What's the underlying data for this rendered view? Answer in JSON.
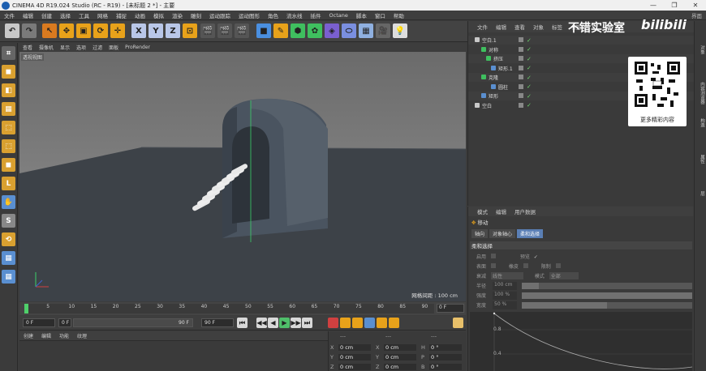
{
  "window": {
    "title": "CINEMA 4D R19.024 Studio (RC - R19) - [未标题 2 *] - 主要",
    "controls": [
      "—",
      "❐",
      "✕"
    ]
  },
  "menubar": {
    "items": [
      "文件",
      "编辑",
      "创建",
      "选择",
      "工具",
      "网格",
      "捕捉",
      "动画",
      "模拟",
      "渲染",
      "雕刻",
      "运动跟踪",
      "运动图形",
      "角色",
      "流水线",
      "插件",
      "Octane",
      "脚本",
      "窗口",
      "帮助"
    ],
    "right": "界面"
  },
  "toolbar": {
    "buttons": [
      {
        "name": "undo-button",
        "glyph": "↶",
        "color": "#c8c8c8"
      },
      {
        "name": "redo-button",
        "glyph": "↷",
        "color": "#7a7a7a"
      },
      {
        "name": "live-select-button",
        "glyph": "↖",
        "color": "#d97a1f"
      },
      {
        "name": "move-button",
        "glyph": "✥",
        "color": "#e8a21a"
      },
      {
        "name": "scale-button",
        "glyph": "▣",
        "color": "#e8a21a"
      },
      {
        "name": "rotate-button",
        "glyph": "⟳",
        "color": "#e8a21a"
      },
      {
        "name": "recent-tool-button",
        "glyph": "✛",
        "color": "#e8a21a"
      },
      {
        "name": "axis-x-button",
        "glyph": "X",
        "color": "#b9c7e8"
      },
      {
        "name": "axis-y-button",
        "glyph": "Y",
        "color": "#b9c7e8"
      },
      {
        "name": "axis-z-button",
        "glyph": "Z",
        "color": "#b9c7e8"
      },
      {
        "name": "coordinate-system-button",
        "glyph": "⊡",
        "color": "#e8a21a"
      },
      {
        "name": "render-view-button",
        "glyph": "🎬",
        "color": "#555"
      },
      {
        "name": "render-picture-viewer-button",
        "glyph": "🎬",
        "color": "#555"
      },
      {
        "name": "render-settings-button",
        "glyph": "🎬",
        "color": "#555"
      },
      {
        "name": "cube-button",
        "glyph": "■",
        "color": "#4a8fe0"
      },
      {
        "name": "pen-button",
        "glyph": "✎",
        "color": "#e8a21a"
      },
      {
        "name": "subdivision-button",
        "glyph": "⬢",
        "color": "#3fbf5f"
      },
      {
        "name": "array-button",
        "glyph": "✿",
        "color": "#3fbf5f"
      },
      {
        "name": "deformer-button",
        "glyph": "◈",
        "color": "#7a5fd0"
      },
      {
        "name": "floor-button",
        "glyph": "⬭",
        "color": "#7a8fe0"
      },
      {
        "name": "sky-button",
        "glyph": "▦",
        "color": "#8fb0e0"
      },
      {
        "name": "camera-button",
        "glyph": "🎥",
        "color": "#666"
      },
      {
        "name": "light-button",
        "glyph": "💡",
        "color": "#ddd"
      }
    ]
  },
  "leftbar": {
    "buttons": [
      {
        "name": "make-editable-button",
        "glyph": "⌗",
        "color": "#666"
      },
      {
        "name": "model-mode-button",
        "glyph": "◼",
        "color": "#d9a030"
      },
      {
        "name": "texture-mode-button",
        "glyph": "◧",
        "color": "#d9a030"
      },
      {
        "name": "workplane-mode-button",
        "glyph": "▦",
        "color": "#d9a030"
      },
      {
        "name": "points-mode-button",
        "glyph": "⬚",
        "color": "#d9a030"
      },
      {
        "name": "edges-mode-button",
        "glyph": "⬚",
        "color": "#d9a030"
      },
      {
        "name": "polygons-mode-button",
        "glyph": "◼",
        "color": "#d9a030"
      },
      {
        "name": "axis-mode-button",
        "glyph": "L",
        "color": "#d9a030"
      },
      {
        "name": "tweak-mode-button",
        "glyph": "✋",
        "color": "#5a8fd0"
      },
      {
        "name": "snapping-button",
        "glyph": "S",
        "color": "#888"
      },
      {
        "name": "workplane-lock-button",
        "glyph": "⟲",
        "color": "#d9a030"
      },
      {
        "name": "solo-button",
        "glyph": "▦",
        "color": "#5a8fd0"
      },
      {
        "name": "grid-snap-button",
        "glyph": "▦",
        "color": "#5a8fd0"
      }
    ]
  },
  "viewport": {
    "menu": [
      "查看",
      "摄像机",
      "显示",
      "选项",
      "过滤",
      "面板",
      "ProRender"
    ],
    "label": "透视视图",
    "grid_label": "网格间距 : 100 cm"
  },
  "timeline": {
    "ticks": [
      "0",
      "5",
      "10",
      "15",
      "20",
      "25",
      "30",
      "35",
      "40",
      "45",
      "50",
      "55",
      "60",
      "65",
      "70",
      "75",
      "80",
      "85",
      "90"
    ],
    "current_frame": "0 F"
  },
  "transport": {
    "start": "0 F",
    "min": "0 F",
    "max": "90 F",
    "end": "90 F",
    "buttons": [
      "⏮",
      "◀◀",
      "◀",
      "▶",
      "▶▶",
      "⏭"
    ]
  },
  "material": {
    "menu": [
      "创建",
      "编辑",
      "功能",
      "纹理"
    ]
  },
  "coords": {
    "header": [
      "---",
      "---",
      "---"
    ],
    "rows": [
      {
        "a": "X",
        "av": "0 cm",
        "b": "X",
        "bv": "0 cm",
        "c": "H",
        "cv": "0 °"
      },
      {
        "a": "Y",
        "av": "0 cm",
        "b": "Y",
        "bv": "0 cm",
        "c": "P",
        "cv": "0 °"
      },
      {
        "a": "Z",
        "av": "0 cm",
        "b": "Z",
        "bv": "0 cm",
        "c": "B",
        "cv": "0 °"
      }
    ]
  },
  "objects": {
    "menu": [
      "文件",
      "编辑",
      "查看",
      "对象",
      "标签",
      "书签"
    ],
    "items": [
      {
        "name": "空白.1",
        "icon": "#c8c8c8",
        "label": "L⁰"
      },
      {
        "name": "对称",
        "icon": "#3fbf5f",
        "label": "⊕"
      },
      {
        "name": "挤压",
        "icon": "#3fbf5f",
        "label": "⊕"
      },
      {
        "name": "矩形.1",
        "icon": "#5a8fd0",
        "label": "┗"
      },
      {
        "name": "克隆",
        "icon": "#3fbf5f",
        "label": "⊕"
      },
      {
        "name": "圆柱",
        "icon": "#5a8fd0",
        "label": "┗"
      },
      {
        "name": "矩形",
        "icon": "#5a8fd0",
        "label": "┗"
      },
      {
        "name": "空白",
        "icon": "#c8c8c8",
        "label": "L⁰"
      }
    ]
  },
  "promo": {
    "watermark": "不错实验室",
    "brand": "bilibili",
    "qr_caption": "更多精彩内容"
  },
  "attributes": {
    "menu": [
      "模式",
      "编辑",
      "用户数据"
    ],
    "title": "移动",
    "tabs": [
      "轴向",
      "对象轴心",
      "柔和选择"
    ],
    "section": "柔和选择",
    "row1": [
      "启用",
      "预览"
    ],
    "row2": [
      "表面",
      "橡皮",
      "限制"
    ],
    "row3_label": "衰减",
    "row3_value": "线性",
    "row3_mode_label": "模式",
    "row3_mode_value": "全部",
    "sliders": [
      {
        "label": "半径",
        "value": "100 cm",
        "fill": 0.1
      },
      {
        "label": "强度",
        "value": "100 %",
        "fill": 1.0
      },
      {
        "label": "宽度",
        "value": "50 %",
        "fill": 0.5
      }
    ],
    "graph_ticks": [
      "0.8",
      "0.4"
    ]
  },
  "rightstrip": {
    "tabs": [
      "对象",
      "内容浏览器",
      "构造",
      "属性",
      "层"
    ]
  }
}
